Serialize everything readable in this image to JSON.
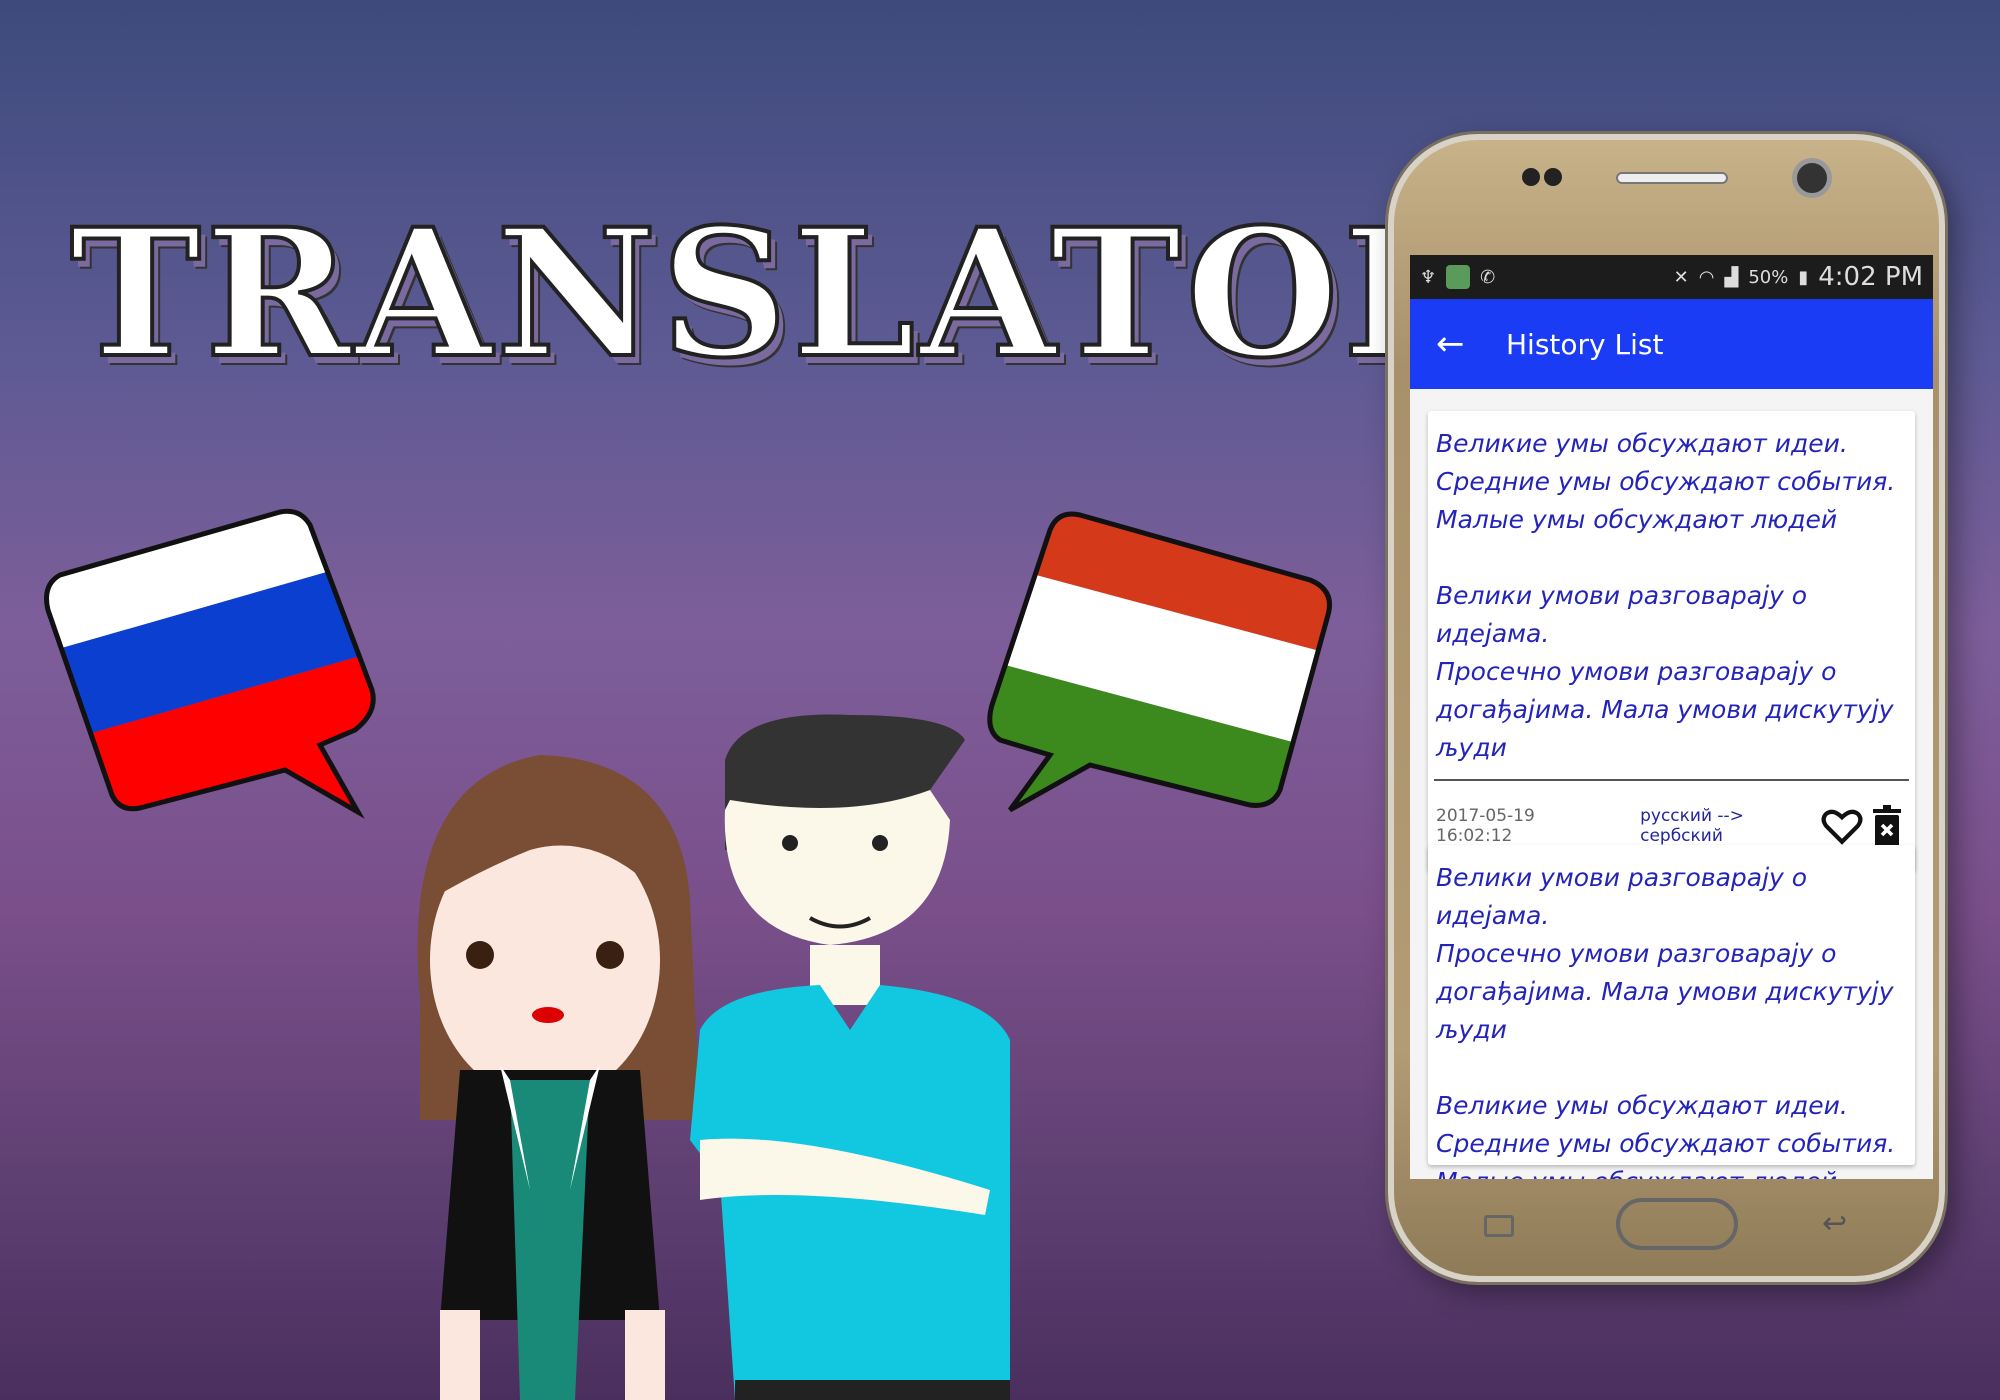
{
  "banner": {
    "title": "TRANSLATOR"
  },
  "status_bar": {
    "battery": "50%",
    "time": "4:02 PM"
  },
  "app_bar": {
    "title": "History List",
    "back_icon": "arrow-left-icon"
  },
  "history": [
    {
      "lines_a": [
        "Великие умы обсуждают идеи.",
        "Средние умы обсуждают события.",
        "Малые умы обсуждают людей"
      ],
      "lines_b": [
        "Велики умови разговарају о идејама.",
        "Просечно умови разговарају о",
        "догађајима. Мала умови дискутују",
        "људи"
      ],
      "date": "2017-05-19 16:02:12",
      "languages": "русский --> сербский"
    },
    {
      "lines_a": [
        "Велики умови разговарају о идејама.",
        "Просечно умови разговарају о",
        "догађајима. Мала умови дискутују",
        "људи"
      ],
      "lines_b": [
        "Великие умы обсуждают идеи.",
        "Средние умы обсуждают события.",
        "Малые умы обсуждают людей"
      ]
    }
  ],
  "colors": {
    "app_bar": "#1a3cf5",
    "text": "#2424b8"
  }
}
